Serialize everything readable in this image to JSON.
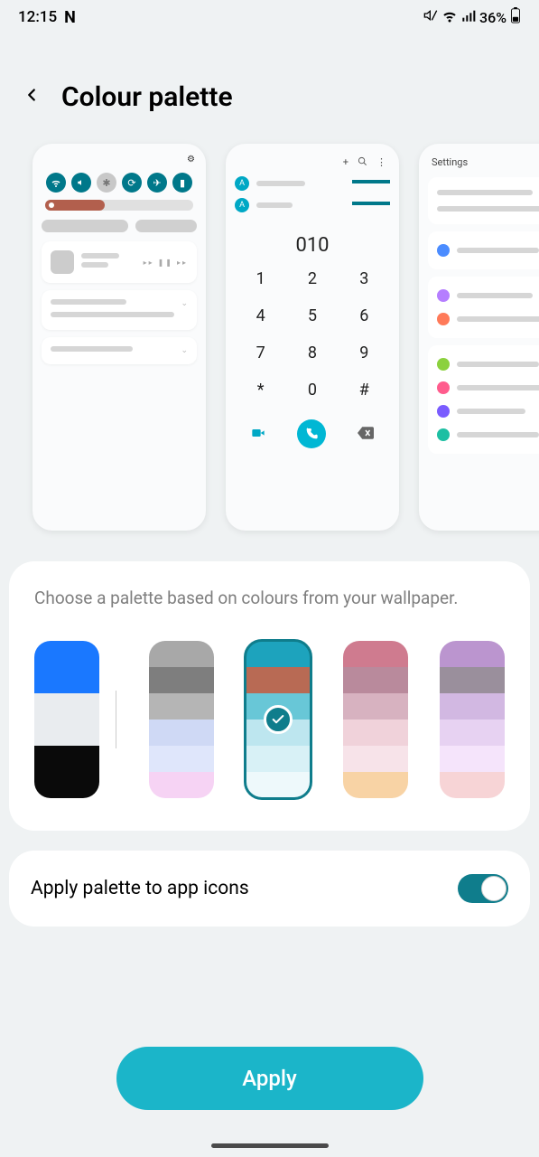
{
  "status": {
    "time": "12:15",
    "app_indicator": "N",
    "battery_text": "36%"
  },
  "header": {
    "title": "Colour palette"
  },
  "previews": {
    "dialer": {
      "contact_initial": "A",
      "display": "010",
      "keys": [
        "1",
        "2",
        "3",
        "4",
        "5",
        "6",
        "7",
        "8",
        "9",
        "*",
        "0",
        "#"
      ]
    },
    "settings": {
      "title": "Settings"
    }
  },
  "palette_section": {
    "description": "Choose a palette based on colours from your wallpaper.",
    "palettes": [
      {
        "colors": [
          "#1a78ff",
          "#1a78ff",
          "#e9ecef",
          "#e9ecef",
          "#0a0a0a",
          "#0a0a0a"
        ],
        "selected": false
      },
      {
        "colors": [
          "#a8a8a8",
          "#7e7e7e",
          "#b5b5b5",
          "#cfd9f5",
          "#dfe6fb",
          "#f6d3f4"
        ],
        "selected": false
      },
      {
        "colors": [
          "#1da3bd",
          "#b86a54",
          "#68c7d7",
          "#bde6ef",
          "#d8f1f6",
          "#eef9fb"
        ],
        "selected": true
      },
      {
        "colors": [
          "#cf7b8f",
          "#b98a9c",
          "#d7b2c0",
          "#f0d2da",
          "#f7e3e9",
          "#f8d3a5"
        ],
        "selected": false
      },
      {
        "colors": [
          "#bb95cf",
          "#9a8f9c",
          "#d2b8e2",
          "#e7d2f2",
          "#f5e4fb",
          "#f7d4d6"
        ],
        "selected": false
      }
    ]
  },
  "icon_toggle": {
    "label": "Apply palette to app icons",
    "on": true
  },
  "apply_button": {
    "label": "Apply"
  }
}
